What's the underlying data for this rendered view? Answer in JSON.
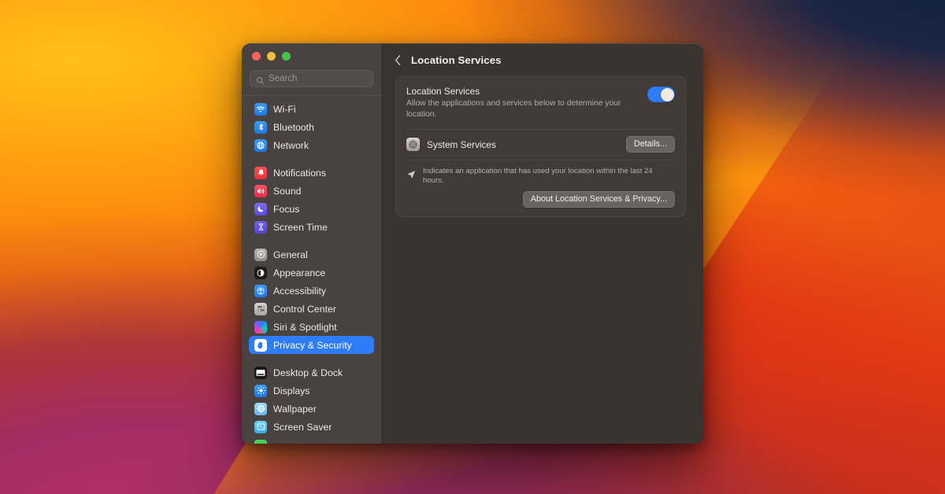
{
  "window": {
    "traffic_lights": [
      {
        "name": "close",
        "color": "#f9655b"
      },
      {
        "name": "minimize",
        "color": "#f6bd3e"
      },
      {
        "name": "zoom",
        "color": "#3fc84b"
      }
    ]
  },
  "sidebar": {
    "search": {
      "value": "",
      "placeholder": "Search",
      "icon": "search-icon"
    },
    "groups": [
      {
        "items": [
          {
            "label": "Wi-Fi",
            "icon": "wifi-icon",
            "selected": false
          },
          {
            "label": "Bluetooth",
            "icon": "bluetooth-icon",
            "selected": false
          },
          {
            "label": "Network",
            "icon": "network-globe-icon",
            "selected": false
          }
        ]
      },
      {
        "items": [
          {
            "label": "Notifications",
            "icon": "notifications-bell-icon",
            "selected": false
          },
          {
            "label": "Sound",
            "icon": "sound-speaker-icon",
            "selected": false
          },
          {
            "label": "Focus",
            "icon": "focus-moon-icon",
            "selected": false
          },
          {
            "label": "Screen Time",
            "icon": "screen-time-hourglass-icon",
            "selected": false
          }
        ]
      },
      {
        "items": [
          {
            "label": "General",
            "icon": "general-gear-icon",
            "selected": false
          },
          {
            "label": "Appearance",
            "icon": "appearance-contrast-icon",
            "selected": false
          },
          {
            "label": "Accessibility",
            "icon": "accessibility-person-icon",
            "selected": false
          },
          {
            "label": "Control Center",
            "icon": "control-center-icon",
            "selected": false
          },
          {
            "label": "Siri & Spotlight",
            "icon": "siri-orb-icon",
            "selected": false
          },
          {
            "label": "Privacy & Security",
            "icon": "privacy-hand-icon",
            "selected": true
          }
        ]
      },
      {
        "items": [
          {
            "label": "Desktop & Dock",
            "icon": "desktop-dock-icon",
            "selected": false
          },
          {
            "label": "Displays",
            "icon": "displays-brightness-icon",
            "selected": false
          },
          {
            "label": "Wallpaper",
            "icon": "wallpaper-flower-icon",
            "selected": false
          },
          {
            "label": "Screen Saver",
            "icon": "screen-saver-icon",
            "selected": false
          }
        ]
      }
    ]
  },
  "detail": {
    "back_icon": "chevron-left-icon",
    "title": "Location Services",
    "location_services": {
      "title": "Location Services",
      "subtitle": "Allow the applications and services below to determine your location.",
      "toggle": {
        "state": "on",
        "accent": "#2f7df6"
      }
    },
    "system_services": {
      "icon": "system-services-icon",
      "label": "System Services",
      "details_button": "Details..."
    },
    "note": {
      "icon": "location-arrow-icon",
      "text": "Indicates an application that has used your location within the last 24 hours."
    },
    "about_button": "About Location Services & Privacy..."
  }
}
